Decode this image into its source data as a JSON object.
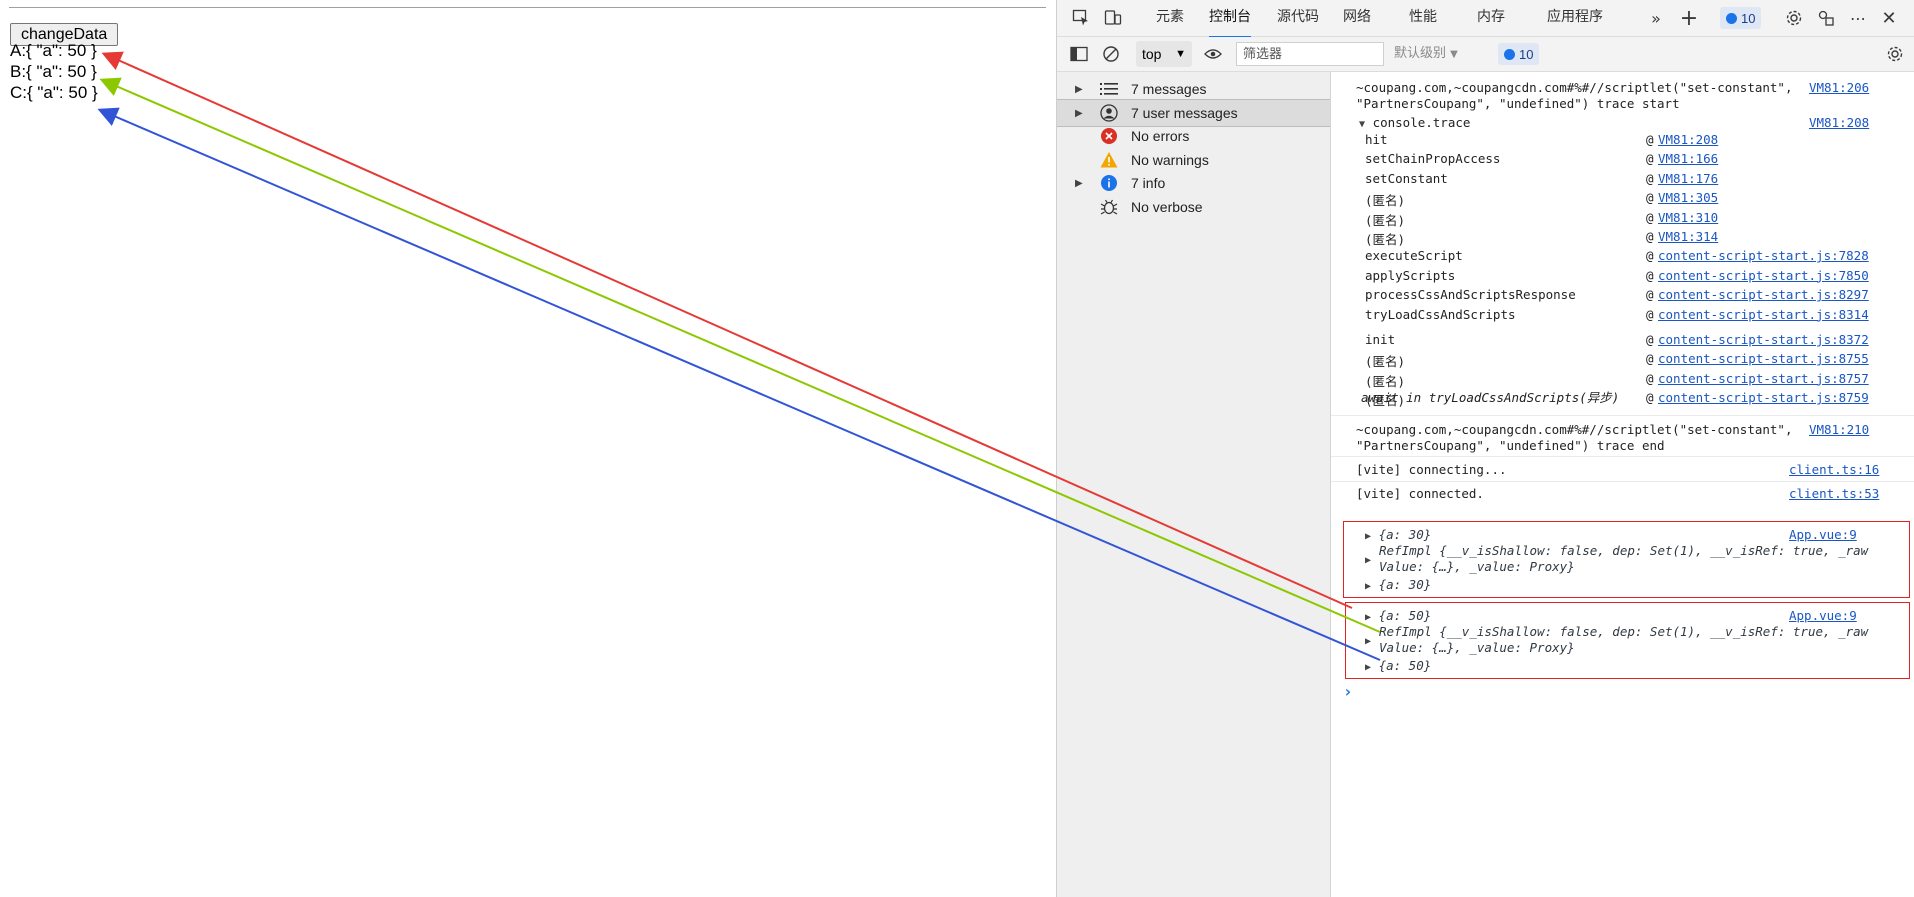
{
  "page": {
    "button_label": "changeData",
    "lines": [
      "A:{ \"a\": 50 }",
      "B:{ \"a\": 50 }",
      "C:{ \"a\": 50 }"
    ]
  },
  "devtools": {
    "tabs": [
      "元素",
      "控制台",
      "源代码",
      "网络",
      "性能",
      "内存",
      "应用程序"
    ],
    "active_tab": "控制台",
    "issues_count": "10",
    "context": "top",
    "filter_placeholder": "筛选器",
    "level_label": "默认级别",
    "toolbar_count": "10"
  },
  "sidebar": {
    "items": [
      {
        "label": "7 messages",
        "icon": "list-icon"
      },
      {
        "label": "7 user messages",
        "icon": "user-icon"
      },
      {
        "label": "No errors",
        "icon": "error-icon"
      },
      {
        "label": "No warnings",
        "icon": "warning-icon"
      },
      {
        "label": "7 info",
        "icon": "info-icon"
      },
      {
        "label": "No verbose",
        "icon": "bug-icon"
      }
    ]
  },
  "console": {
    "msg1_text_a": "~coupang.com,~coupangcdn.com#%#//scriptlet(\"set-constant\",",
    "msg1_text_b": "\"PartnersCoupang\", \"undefined\") trace start",
    "msg1_link": "VM81:206",
    "trace_header": "console.trace",
    "trace_link": "VM81:208",
    "trace_rows_1": [
      {
        "fn": "hit",
        "loc": "VM81:208"
      },
      {
        "fn": "setChainPropAccess",
        "loc": "VM81:166"
      },
      {
        "fn": "setConstant",
        "loc": "VM81:176"
      },
      {
        "fn": "(匿名)",
        "loc": "VM81:305"
      },
      {
        "fn": "(匿名)",
        "loc": "VM81:310"
      },
      {
        "fn": "(匿名)",
        "loc": "VM81:314"
      },
      {
        "fn": "executeScript",
        "loc": "content-script-start.js:7828"
      },
      {
        "fn": "applyScripts",
        "loc": "content-script-start.js:7850"
      },
      {
        "fn": "processCssAndScriptsResponse",
        "loc": "content-script-start.js:8297"
      },
      {
        "fn": "tryLoadCssAndScripts",
        "loc": "content-script-start.js:8314"
      }
    ],
    "await_text": "await in tryLoadCssAndScripts(异步)",
    "trace_rows_2": [
      {
        "fn": "init",
        "loc": "content-script-start.js:8372"
      },
      {
        "fn": "(匿名)",
        "loc": "content-script-start.js:8755"
      },
      {
        "fn": "(匿名)",
        "loc": "content-script-start.js:8757"
      },
      {
        "fn": "(匿名)",
        "loc": "content-script-start.js:8759"
      }
    ],
    "at_sign": "@",
    "msg2_text_a": "~coupang.com,~coupangcdn.com#%#//scriptlet(\"set-constant\",",
    "msg2_text_b": "\"PartnersCoupang\", \"undefined\") trace end",
    "msg2_link": "VM81:210",
    "vite1": "[vite] connecting...",
    "vite1_link": "client.ts:16",
    "vite2": "[vite] connected.",
    "vite2_link": "client.ts:53",
    "group1": {
      "link": "App.vue:9",
      "first": "{a: 30}",
      "ref_a": "RefImpl {__v_isShallow: false, dep: Set(1), __v_isRef: true, _raw",
      "ref_b": "Value: {…}, _value: Proxy}",
      "last": "{a: 30}"
    },
    "group2": {
      "link": "App.vue:9",
      "first": "{a: 50}",
      "ref_a": "RefImpl {__v_isShallow: false, dep: Set(1), __v_isRef: true, _raw",
      "ref_b": "Value: {…}, _value: Proxy}",
      "last": "{a: 50}"
    },
    "prompt": "›"
  },
  "colors": {
    "arrow_a": "#e53935",
    "arrow_b": "#8cc800",
    "arrow_c": "#3155d6",
    "highlight_box": "#e02424",
    "accent": "#1a73e8"
  }
}
